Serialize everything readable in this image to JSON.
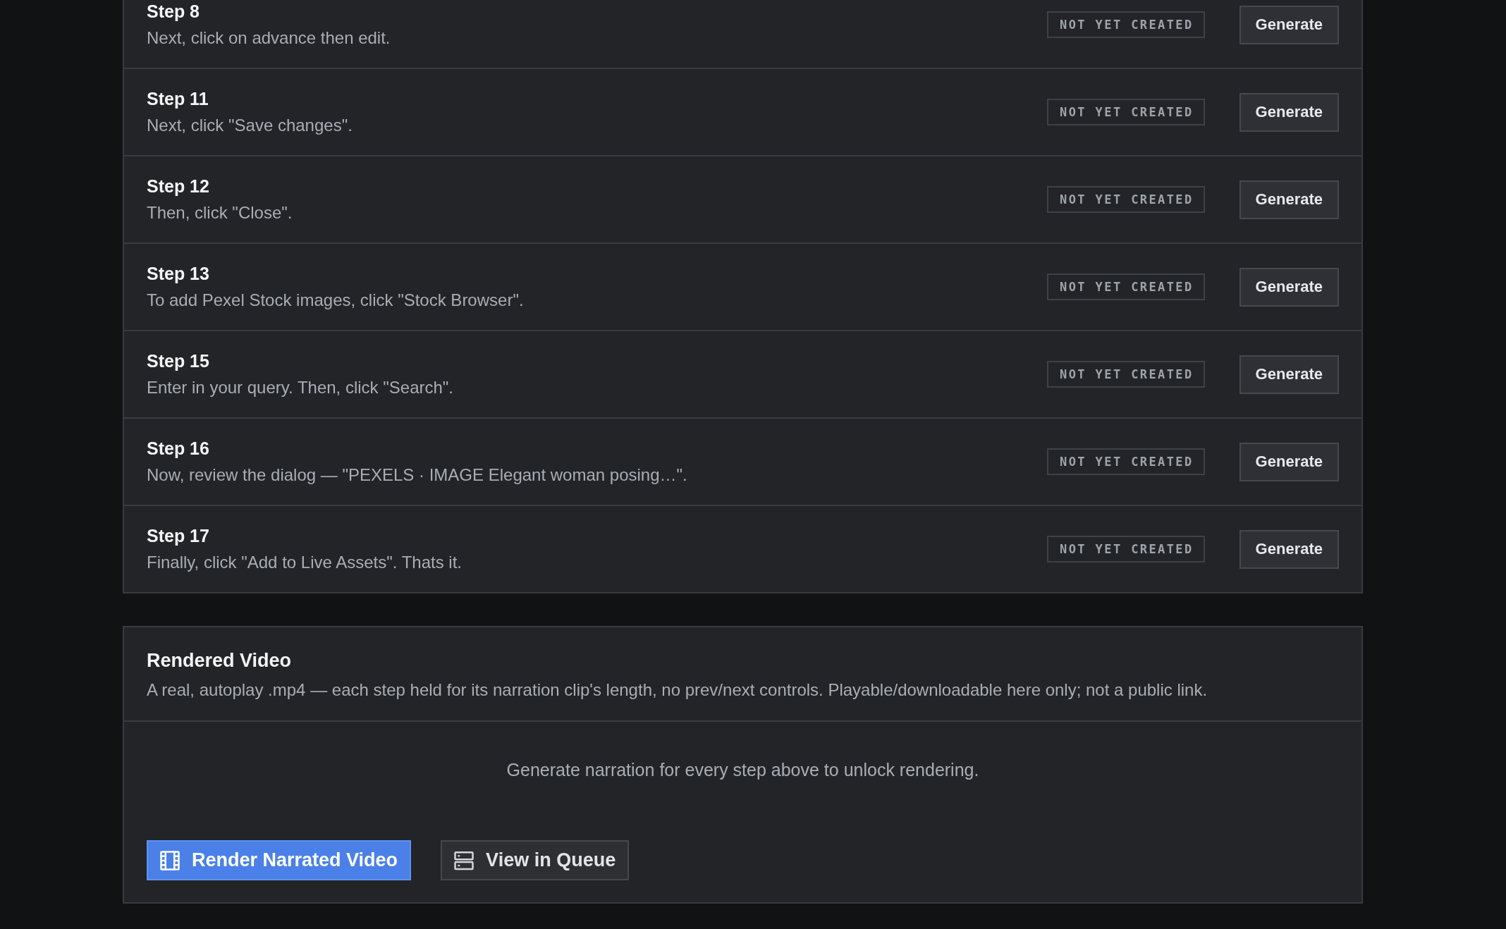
{
  "steps": [
    {
      "title": "Step 8",
      "description": "Next, click on advance then edit.",
      "status": "NOT YET CREATED",
      "action": "Generate"
    },
    {
      "title": "Step 11",
      "description": "Next, click \"Save changes\".",
      "status": "NOT YET CREATED",
      "action": "Generate"
    },
    {
      "title": "Step 12",
      "description": "Then, click \"Close\".",
      "status": "NOT YET CREATED",
      "action": "Generate"
    },
    {
      "title": "Step 13",
      "description": "To add Pexel Stock images, click \"Stock Browser\".",
      "status": "NOT YET CREATED",
      "action": "Generate"
    },
    {
      "title": "Step 15",
      "description": "Enter in your query. Then, click \"Search\".",
      "status": "NOT YET CREATED",
      "action": "Generate"
    },
    {
      "title": "Step 16",
      "description": "Now, review the dialog — \"PEXELS · IMAGE Elegant woman posing…\".",
      "status": "NOT YET CREATED",
      "action": "Generate"
    },
    {
      "title": "Step 17",
      "description": "Finally, click \"Add to Live Assets\". Thats it.",
      "status": "NOT YET CREATED",
      "action": "Generate"
    }
  ],
  "rendered_video": {
    "title": "Rendered Video",
    "description": "A real, autoplay .mp4 — each step held for its narration clip's length, no prev/next controls. Playable/downloadable here only; not a public link.",
    "message": "Generate narration for every step above to unlock rendering.",
    "buttons": [
      {
        "label": "Render Narrated Video",
        "kind": "primary"
      },
      {
        "label": "View in Queue",
        "kind": "secondary"
      }
    ]
  }
}
